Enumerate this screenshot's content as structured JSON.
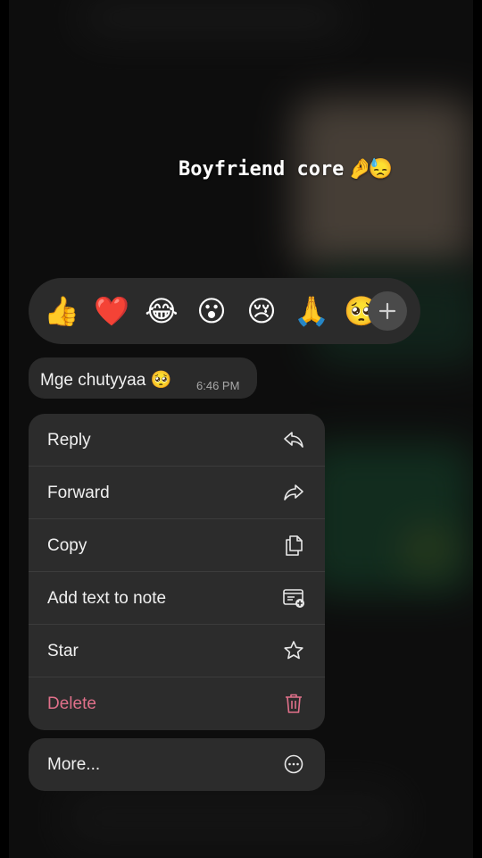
{
  "caption": {
    "text": "Boyfriend core",
    "emojis": [
      "🤌",
      "😓"
    ]
  },
  "reactions": [
    "👍",
    "❤️",
    "😂",
    "😮",
    "😢",
    "🙏",
    "🥺"
  ],
  "reaction_more_icon": "plus-icon",
  "message": {
    "text": "Mge chutyyaa",
    "emoji": "🥺",
    "time": "6:46 PM"
  },
  "menu": [
    {
      "label": "Reply",
      "icon": "reply-icon"
    },
    {
      "label": "Forward",
      "icon": "forward-icon"
    },
    {
      "label": "Copy",
      "icon": "copy-icon"
    },
    {
      "label": "Add text to note",
      "icon": "add-note-icon"
    },
    {
      "label": "Star",
      "icon": "star-icon"
    },
    {
      "label": "Delete",
      "icon": "trash-icon",
      "color": "#e0708a"
    }
  ],
  "more": {
    "label": "More...",
    "icon": "more-icon"
  }
}
